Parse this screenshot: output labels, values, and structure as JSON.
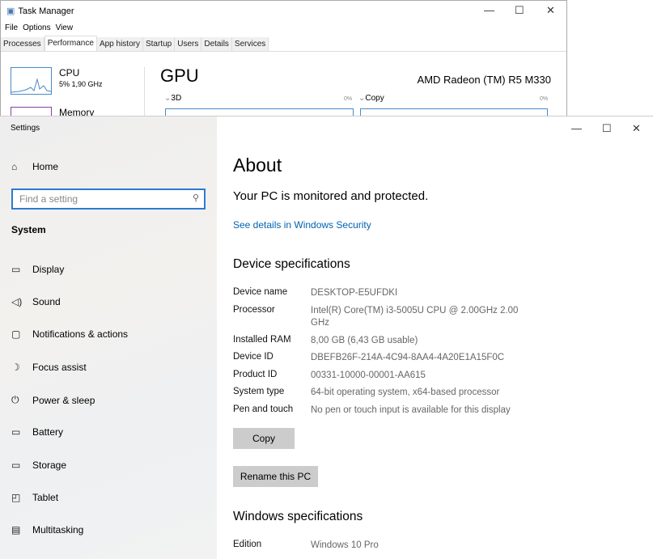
{
  "task_manager": {
    "title": "Task Manager",
    "menu": [
      "File",
      "Options",
      "View"
    ],
    "tabs": [
      "Processes",
      "Performance",
      "App history",
      "Startup",
      "Users",
      "Details",
      "Services"
    ],
    "active_tab": "Performance",
    "cpu_label": "CPU",
    "cpu_value": "5% 1,90 GHz",
    "memory_label": "Memory",
    "gpu_title": "GPU",
    "gpu_name": "AMD Radeon (TM) R5 M330",
    "graph1_label": "3D",
    "graph1_value": "0%",
    "graph2_label": "Copy",
    "graph2_value": "0%"
  },
  "settings": {
    "title": "Settings",
    "home": "Home",
    "search_placeholder": "Find a setting",
    "section": "System",
    "nav": [
      {
        "label": "Display",
        "icon": "monitor-icon"
      },
      {
        "label": "Sound",
        "icon": "speaker-icon"
      },
      {
        "label": "Notifications & actions",
        "icon": "notification-icon"
      },
      {
        "label": "Focus assist",
        "icon": "moon-icon"
      },
      {
        "label": "Power & sleep",
        "icon": "power-icon"
      },
      {
        "label": "Battery",
        "icon": "battery-icon"
      },
      {
        "label": "Storage",
        "icon": "storage-icon"
      },
      {
        "label": "Tablet",
        "icon": "tablet-icon"
      },
      {
        "label": "Multitasking",
        "icon": "multitasking-icon"
      }
    ],
    "page_title": "About",
    "protected": "Your PC is monitored and protected.",
    "security_link": "See details in Windows Security",
    "device_heading": "Device specifications",
    "specs": [
      {
        "k": "Device name",
        "v": "DESKTOP-E5UFDKI"
      },
      {
        "k": "Processor",
        "v": "Intel(R) Core(TM) i3-5005U CPU @ 2.00GHz   2.00 GHz"
      },
      {
        "k": "Installed RAM",
        "v": "8,00 GB (6,43 GB usable)"
      },
      {
        "k": "Device ID",
        "v": "DBEFB26F-214A-4C94-8AA4-4A20E1A15F0C"
      },
      {
        "k": "Product ID",
        "v": "00331-10000-00001-AA615"
      },
      {
        "k": "System type",
        "v": "64-bit operating system, x64-based processor"
      },
      {
        "k": "Pen and touch",
        "v": "No pen or touch input is available for this display"
      }
    ],
    "copy": "Copy",
    "rename": "Rename this PC",
    "windows_heading": "Windows specifications",
    "edition_label": "Edition",
    "edition_value": "Windows 10 Pro"
  }
}
